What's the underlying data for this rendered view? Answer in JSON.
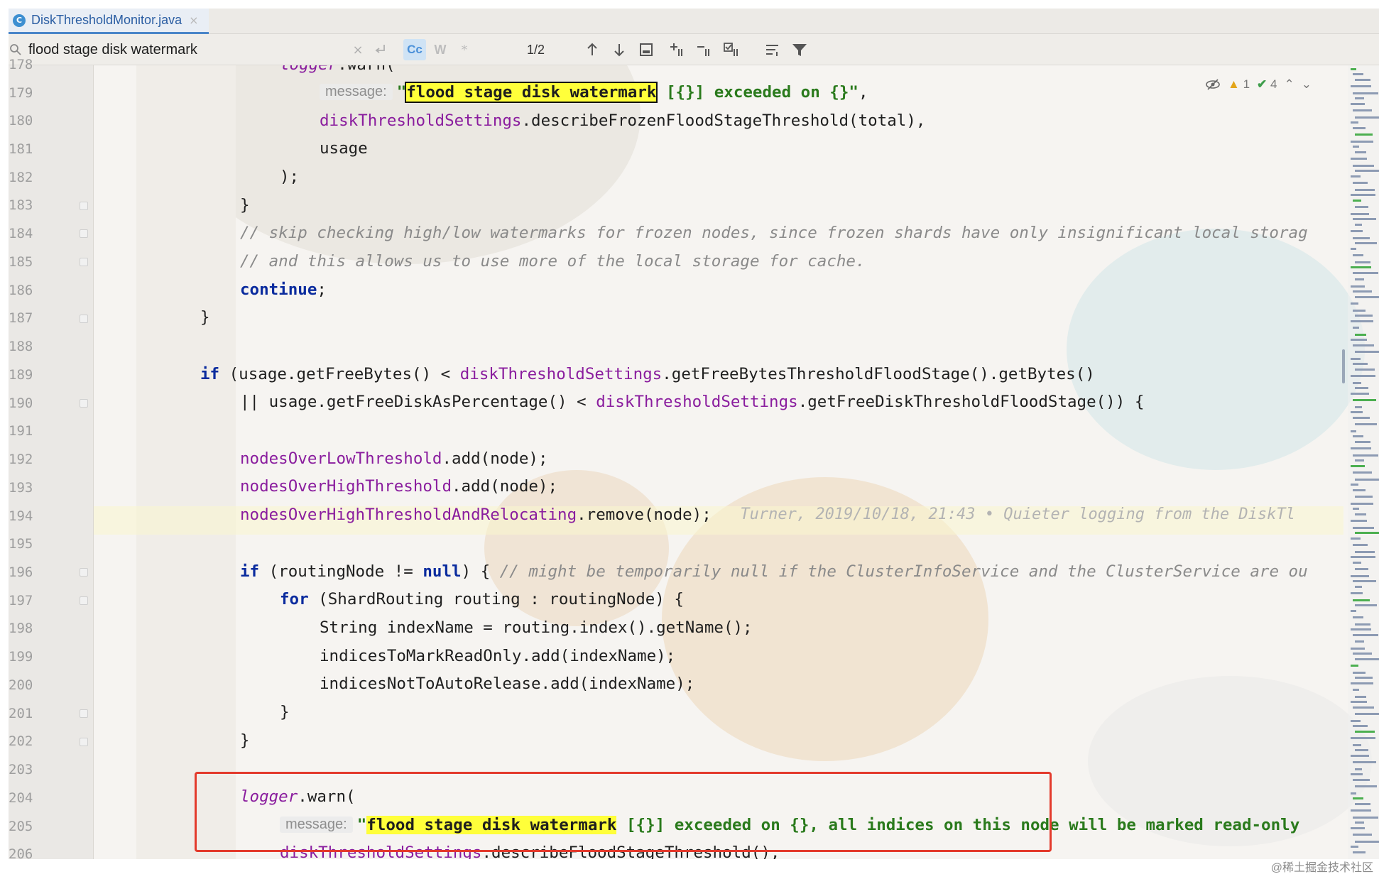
{
  "tab": {
    "title": "DiskThresholdMonitor.java",
    "icon_letter": "C",
    "close": "×"
  },
  "search": {
    "query": "flood stage disk watermark",
    "match_case_label": "Cc",
    "words_label": "W",
    "regex_label": "*",
    "match_count": "1/2",
    "clear": "×"
  },
  "inspections": {
    "warnings": "1",
    "checks": "4"
  },
  "line_numbers": [
    "178",
    "179",
    "180",
    "181",
    "182",
    "183",
    "184",
    "185",
    "186",
    "187",
    "188",
    "189",
    "190",
    "191",
    "192",
    "193",
    "194",
    "195",
    "196",
    "197",
    "198",
    "199",
    "200",
    "201",
    "202",
    "203",
    "204",
    "205",
    "206"
  ],
  "code": {
    "l178_field": "logger",
    "l178_rest": ".warn(",
    "hint_message": "message:",
    "l179_q": "\"",
    "l179_match": "flood stage disk watermark",
    "l179_rest": " [{}] exceeded on {}\"",
    "l179_tail": ",",
    "l180_field": "diskThresholdSettings",
    "l180_rest": ".describeFrozenFloodStageThreshold(total),",
    "l181": "usage",
    "l182": ");",
    "l183": "}",
    "l184": "// skip checking high/low watermarks for frozen nodes, since frozen shards have only insignificant local storag",
    "l185": "// and this allows us to use more of the local storage for cache.",
    "l186_kw": "continue",
    "l186_rest": ";",
    "l187": "}",
    "l189_kw": "if",
    "l189_a": " (usage.getFreeBytes() < ",
    "l189_field": "diskThresholdSettings",
    "l189_b": ".getFreeBytesThresholdFloodStage().getBytes()",
    "l190_a": "|| usage.getFreeDiskAsPercentage() < ",
    "l190_field": "diskThresholdSettings",
    "l190_b": ".getFreeDiskThresholdFloodStage()) {",
    "l192_field": "nodesOverLowThreshold",
    "l192_rest": ".add(node);",
    "l193_field": "nodesOverHighThreshold",
    "l193_rest": ".add(node);",
    "l194_field": "nodesOverHighThresholdAndRelocating",
    "l194_rest": ".remove(node);",
    "l194_blame": "Turner, 2019/10/18, 21:43 • Quieter logging from the DiskTl",
    "l196_kw": "if",
    "l196_a": " (routingNode != ",
    "l196_null": "null",
    "l196_b": ") { ",
    "l196_cmt": "// might be temporarily null if the ClusterInfoService and the ClusterService are ou",
    "l197_kw": "for",
    "l197_rest": " (ShardRouting routing : routingNode) {",
    "l198": "String indexName = routing.index().getName();",
    "l199": "indicesToMarkReadOnly.add(indexName);",
    "l200": "indicesNotToAutoRelease.add(indexName);",
    "l201": "}",
    "l202": "}",
    "l204_field": "logger",
    "l204_rest": ".warn(",
    "l205_q": "\"",
    "l205_match": "flood stage disk watermark",
    "l205_rest": " [{}] exceeded on {}, all indices on this node will be marked read-only",
    "l206_field": "diskThresholdSettings",
    "l206_rest": ".describeFloodStageThreshold(),"
  },
  "watermark": "@稀土掘金技术社区",
  "colors": {
    "keyword": "#0a2b9e",
    "field": "#8a1d9e",
    "string": "#2a7a1c",
    "comment": "#8a8a8a",
    "match": "#ffff3a",
    "annotation": "#e33a2c"
  }
}
